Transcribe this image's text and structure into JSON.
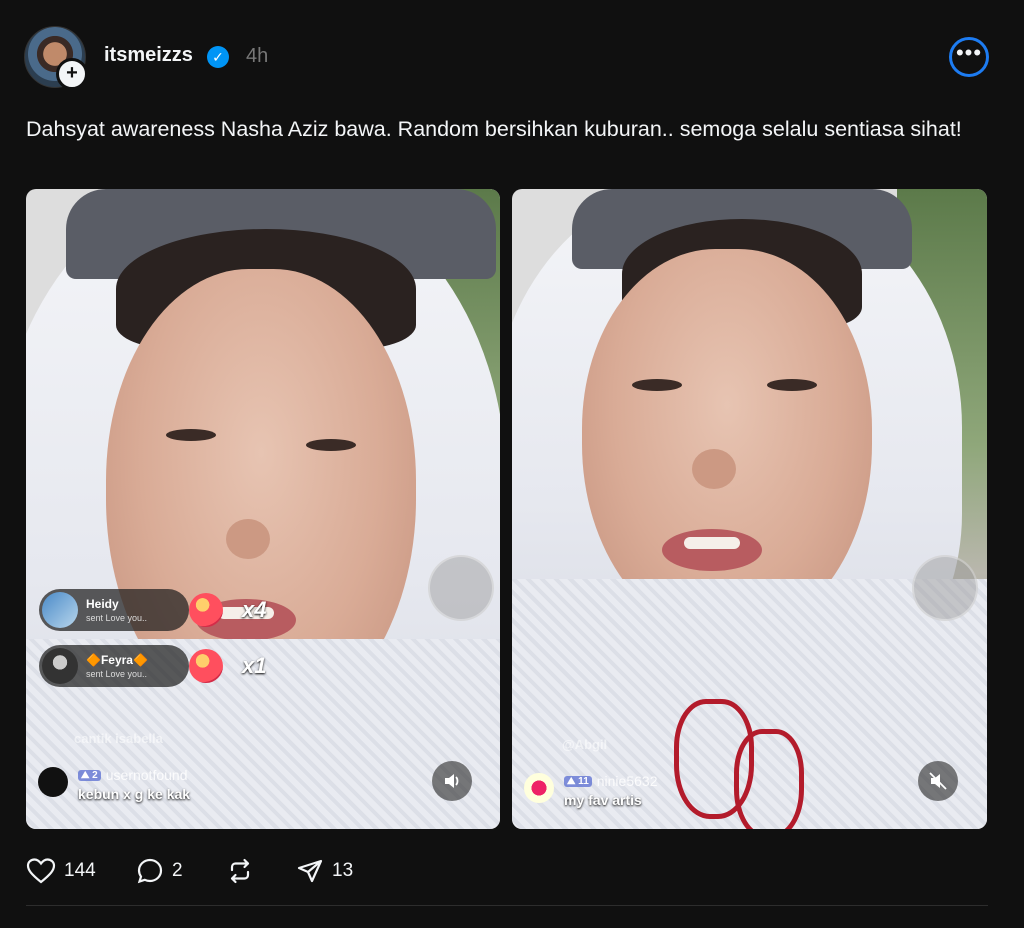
{
  "post": {
    "username": "itsmeizzs",
    "timestamp": "4h",
    "caption": "Dahsyat awareness Nasha Aziz bawa. Random bersihkan kuburan.. semoga selalu sentiasa sihat!"
  },
  "media": [
    {
      "gifts": [
        {
          "name": "Heidy",
          "sub": "sent Love you..",
          "count": "x4"
        },
        {
          "name": "🔶Feyra🔶",
          "sub": "sent Love you..",
          "count": "x1"
        }
      ],
      "faded_user": "cantik isabella",
      "comment": {
        "badge": "⛰ 2",
        "user": "usernotfound",
        "text": "kebun x g ke kak"
      },
      "sound_icon": "speaker-on-icon"
    },
    {
      "faded_user": "@Abgil",
      "comment": {
        "badge": "⛰ 11",
        "user": "ninie5632",
        "text": "my fav artis"
      },
      "sound_icon": "speaker-muted-icon"
    }
  ],
  "actions": {
    "likes": "144",
    "replies": "2",
    "reposts": "",
    "shares": "13"
  },
  "colors": {
    "background": "#101010",
    "verified": "#0095f6",
    "more_ring": "#1d7cf2"
  }
}
